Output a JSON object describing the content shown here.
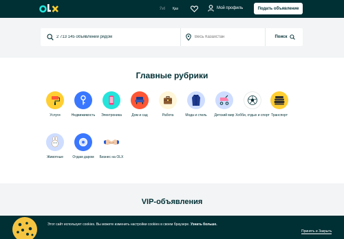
{
  "header": {
    "lang_uz": "Ўзб",
    "lang_ru": "Қаз",
    "profile_label": "Мой профиль",
    "post_button": "Подать объявление"
  },
  "search": {
    "query": "2 713 145 объявлений рядом",
    "location_placeholder": "Весь Казахстан",
    "button_label": "Поиск"
  },
  "categories": {
    "title": "Главные рубрики",
    "items": [
      {
        "label": "Услуги",
        "color": "#ffce32"
      },
      {
        "label": "Недвижимость",
        "color": "#3a77ff"
      },
      {
        "label": "Электроника",
        "color": "#23e5db"
      },
      {
        "label": "Дом и сад",
        "color": "#ff5636"
      },
      {
        "label": "Работа",
        "color": "#fff6d9"
      },
      {
        "label": "Мода и стиль",
        "color": "#ceddff"
      },
      {
        "label": "Детский мир",
        "color": "#ffce32"
      },
      {
        "label": "Хобби, отдых и спорт",
        "color": "#ffffff"
      },
      {
        "label": "Транспорт",
        "color": "#ffce32"
      },
      {
        "label": "Животные",
        "color": "#ceddff"
      },
      {
        "label": "Отдам даром",
        "color": "#3a77ff"
      },
      {
        "label": "Бизнес на OLX",
        "color": "#ffffff"
      }
    ]
  },
  "vip": {
    "title": "VIP-объявления"
  },
  "cookie": {
    "text": "Этот сайт использует cookies. Вы можете изменить настройки cookies в своем браузере.",
    "more_link": "Узнать больше.",
    "accept": "Принять и Закрыть"
  },
  "colors": {
    "brand_dark": "#002f34",
    "brand_accent": "#23e5db",
    "background_light": "#f2f4f5"
  }
}
